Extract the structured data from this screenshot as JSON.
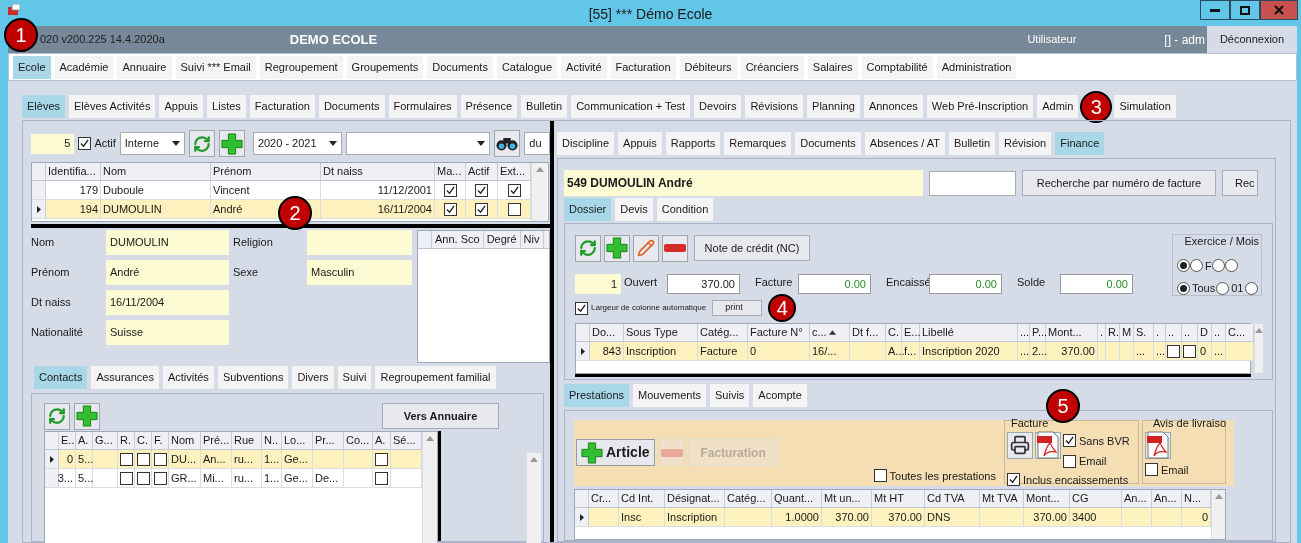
{
  "window": {
    "title": "[55] *** Démo Ecole"
  },
  "header": {
    "version": "020 v200.225 14.4.2020a",
    "school": "DEMO ECOLE",
    "user_label": "Utilisateur",
    "user": "[] - adm",
    "logout": "Déconnexion"
  },
  "main_menu": [
    {
      "label": "Ecole",
      "selected": true
    },
    {
      "label": "Académie",
      "selected": false
    },
    {
      "label": "Annuaire",
      "selected": false
    },
    {
      "label": "Suivi *** Email",
      "selected": false
    },
    {
      "label": "Regroupement",
      "selected": false
    },
    {
      "label": "Groupements",
      "selected": false
    },
    {
      "label": "Documents",
      "selected": false
    },
    {
      "label": "Catalogue",
      "selected": false
    },
    {
      "label": "Activité",
      "selected": false
    },
    {
      "label": "Facturation",
      "selected": false
    },
    {
      "label": "Débiteurs",
      "selected": false
    },
    {
      "label": "Créanciers",
      "selected": false
    },
    {
      "label": "Salaires",
      "selected": false
    },
    {
      "label": "Comptabilité",
      "selected": false
    },
    {
      "label": "Administration",
      "selected": false
    }
  ],
  "sub_tabs": [
    {
      "label": "Elèves",
      "selected": true
    },
    {
      "label": "Elèves Activités",
      "selected": false
    },
    {
      "label": "Appuis",
      "selected": false
    },
    {
      "label": "Listes",
      "selected": false
    },
    {
      "label": "Facturation",
      "selected": false
    },
    {
      "label": "Documents",
      "selected": false
    },
    {
      "label": "Formulaires",
      "selected": false
    },
    {
      "label": "Présence",
      "selected": false
    },
    {
      "label": "Bulletin",
      "selected": false
    },
    {
      "label": "Communication + Test",
      "selected": false
    },
    {
      "label": "Devoirs",
      "selected": false
    },
    {
      "label": "Révisions",
      "selected": false
    },
    {
      "label": "Planning",
      "selected": false
    },
    {
      "label": "Annonces",
      "selected": false
    },
    {
      "label": "Web Pré-Inscription",
      "selected": false
    },
    {
      "label": "Admin",
      "selected": false
    },
    {
      "label": "Simulation",
      "selected": false
    }
  ],
  "filter": {
    "count": "5",
    "actif": {
      "label": "Actif",
      "checked": true
    },
    "type": "Interne",
    "year": "2020 - 2021",
    "du": "du"
  },
  "students": {
    "columns": [
      "Identifia...",
      "Nom",
      "Prénom",
      "Dt naiss",
      "Ma...",
      "Actif",
      "Ext..."
    ],
    "rows": [
      {
        "selected": false,
        "cells": [
          "179",
          "Duboule",
          "Vincent",
          "11/12/2001",
          {
            "check": true
          },
          {
            "check": true
          },
          {
            "check": true
          }
        ]
      },
      {
        "selected": true,
        "cells": [
          "194",
          "DUMOULIN",
          "André",
          "16/11/2004",
          {
            "check": true
          },
          {
            "check": true
          },
          {
            "check": false
          }
        ]
      }
    ]
  },
  "details": {
    "left": [
      {
        "label": "Nom",
        "value": "DUMOULIN"
      },
      {
        "label": "Prénom",
        "value": "André"
      },
      {
        "label": "Dt naiss",
        "value": "16/11/2004"
      },
      {
        "label": "Nationalité",
        "value": "Suisse"
      }
    ],
    "right": [
      {
        "label": "Religion"
      },
      {
        "label": "Sexe",
        "value": "Masculin"
      }
    ],
    "years_columns": [
      "Ann. Sco",
      "Degré",
      "Niv"
    ]
  },
  "contact_tabs": [
    {
      "label": "Contacts",
      "selected": true
    },
    {
      "label": "Assurances",
      "selected": false
    },
    {
      "label": "Activités",
      "selected": false
    },
    {
      "label": "Subventions",
      "selected": false
    },
    {
      "label": "Divers",
      "selected": false
    },
    {
      "label": "Suivi",
      "selected": false
    },
    {
      "label": "Regroupement familial",
      "selected": false
    }
  ],
  "contacts": {
    "button": "Vers Annuaire",
    "columns": [
      "E..",
      "A.",
      "G...",
      "R.",
      "C.",
      "F.",
      "Nom",
      "Pré...",
      "Rue",
      "N..",
      "Lo...",
      "Pr...",
      "Co...",
      "A.",
      "Sé..."
    ],
    "rows": [
      {
        "selected": true,
        "cells": [
          "0",
          "5...",
          null,
          {
            "check": false
          },
          {
            "check": false
          },
          {
            "check": false
          },
          "DU...",
          "An...",
          "ru...",
          "1...",
          "Ge...",
          null,
          null,
          {
            "check": false
          },
          null
        ]
      },
      {
        "selected": false,
        "cells": [
          "3...",
          "5...",
          null,
          {
            "check": false
          },
          {
            "check": false
          },
          {
            "check": false
          },
          "GR...",
          "Mi...",
          "ru...",
          "1...",
          "Ge...",
          "De...",
          null,
          {
            "check": false
          },
          null
        ]
      }
    ]
  },
  "detail_tabs": [
    {
      "label": "Discipline",
      "selected": false
    },
    {
      "label": "Appuis",
      "selected": false
    },
    {
      "label": "Rapports",
      "selected": false
    },
    {
      "label": "Remarques",
      "selected": false
    },
    {
      "label": "Documents",
      "selected": false
    },
    {
      "label": "Absences / AT",
      "selected": false
    },
    {
      "label": "Bulletin",
      "selected": false
    },
    {
      "label": "Révision",
      "selected": false
    },
    {
      "label": "Finance",
      "selected": true
    }
  ],
  "finance": {
    "student": "549 DUMOULIN André",
    "search_button": "Recherche par numéro de facture",
    "next_button": "Rec",
    "tabs": [
      {
        "label": "Dossier",
        "selected": true
      },
      {
        "label": "Devis",
        "selected": false
      },
      {
        "label": "Condition",
        "selected": false
      }
    ],
    "credit_note": "Note de crédit (NC)",
    "exercise": {
      "title": "Exercice / Mois",
      "row_1": [
        {
          "selected": true
        },
        {
          "label": "F",
          "selected": false
        },
        {
          "selected": false
        },
        {
          "selected": false
        }
      ],
      "row_2": [
        {
          "label": "Tous",
          "selected": true
        },
        {
          "label": "01",
          "selected": false
        },
        {
          "selected": false
        }
      ]
    },
    "count": "1",
    "totals": [
      {
        "label": "Ouvert",
        "value": "370.00"
      },
      {
        "label": "Facture",
        "value": "0.00"
      },
      {
        "label": "Encaissé",
        "value": "0.00"
      },
      {
        "label": "Solde",
        "value": "0.00"
      }
    ],
    "auto_width": {
      "label": "Largeur de colonne automatique",
      "checked": true
    },
    "print_button": "print",
    "invoices": {
      "columns": [
        "Do...",
        "Sous Type",
        "Catég...",
        "Facture N°",
        "c...",
        "Dt f...",
        "C.",
        "E...",
        "Libellé",
        "...",
        "P...",
        "Mont...",
        ".",
        "R.",
        "M",
        "S.",
        ".",
        "..",
        "..",
        "D",
        "..",
        "C..."
      ],
      "rows": [
        {
          "selected": true,
          "cells": [
            "843",
            "Inscription",
            "Facture",
            "0",
            "16/...",
            null,
            "A...",
            "f...",
            "Inscription 2020",
            "...",
            "2...",
            "370.00",
            null,
            null,
            null,
            "...",
            "...",
            {
              "check": false
            },
            {
              "check": false
            },
            "0",
            "...",
            null
          ]
        }
      ]
    }
  },
  "services": {
    "tabs": [
      {
        "label": "Prestations",
        "selected": true
      },
      {
        "label": "Mouvements",
        "selected": false
      },
      {
        "label": "Suivis",
        "selected": false
      },
      {
        "label": "Acompte",
        "selected": false
      }
    ],
    "article_button": "Article",
    "remove_button": {
      "disabled": true
    },
    "billing_button": {
      "label": "Facturation",
      "disabled": true
    },
    "all_services": {
      "label": "Toutes les prestations",
      "checked": false
    },
    "invoice_group": {
      "title": "Facture",
      "no_bvr": {
        "label": "Sans BVR",
        "checked": true
      },
      "email": {
        "label": "Email",
        "checked": false
      },
      "include_payments": {
        "label": "Inclus encaissements",
        "checked": true
      }
    },
    "delivery_group": {
      "title": "Avis de livraiso",
      "email": {
        "label": "Email",
        "checked": false
      }
    },
    "table": {
      "columns": [
        "Cr...",
        "Cd Int.",
        "Désignat...",
        "Catég...",
        "Quant...",
        "Mt un...",
        "Mt HT",
        "Cd TVA",
        "Mt TVA",
        "Mont...",
        "CG",
        "An...",
        "An...",
        "N..."
      ],
      "rows": [
        {
          "selected": true,
          "cells": [
            null,
            "Insc",
            "Inscription",
            null,
            "1.0000",
            "370.00",
            "370.00",
            "DNS",
            null,
            "370.00",
            "3400",
            null,
            null,
            "0"
          ]
        }
      ]
    }
  },
  "callouts": [
    "1",
    "2",
    "3",
    "4",
    "5"
  ]
}
